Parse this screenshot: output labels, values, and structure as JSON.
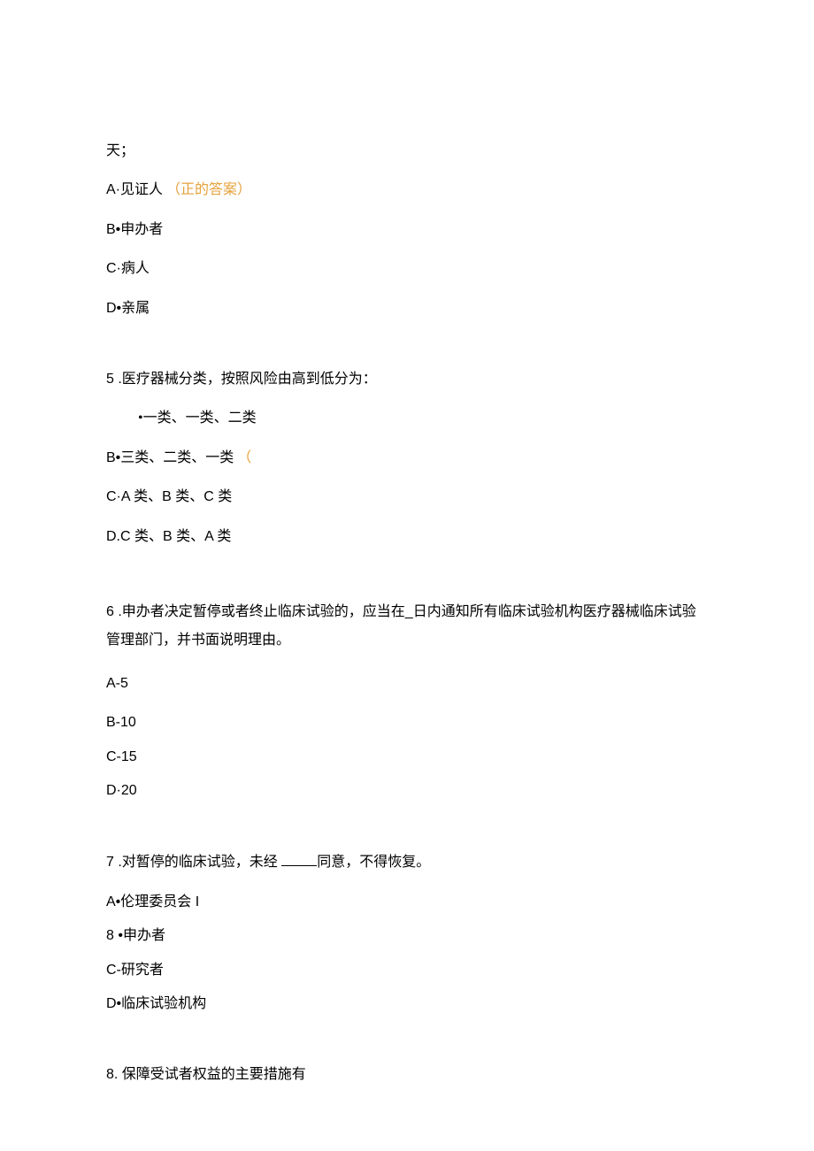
{
  "q4": {
    "tail": "天；",
    "opts": {
      "A": "A·见证人",
      "A_hint": "（正的答案）",
      "B": "B•申办者",
      "C": "C·病人",
      "D": "D•亲属"
    }
  },
  "q5": {
    "stem": "5  .医疗器械分类，按照风险由高到低分为：",
    "opts": {
      "A": "•一类、一类、二类",
      "B": "B•三类、二类、一类",
      "B_hint": "（",
      "C": "C·A 类、B 类、C 类",
      "D": "D.C 类、B 类、A 类"
    }
  },
  "q6": {
    "stem": "6  .申办者决定暂停或者终止临床试验的，应当在_日内通知所有临床试验机构医疗器械临床试验管理部门，并书面说明理由。",
    "opts": {
      "A": "A-5",
      "B": "B-10",
      "C": "C-15",
      "D": "D·20"
    }
  },
  "q7": {
    "stem_pre": "7  .对暂停的临床试验，未经 ",
    "stem_post": "同意，不得恢复。",
    "opts": {
      "A": "A•伦理委员会 I",
      "B": "8   •申办者",
      "C": "C-研究者",
      "D": "D•临床试验机构"
    }
  },
  "q8": {
    "stem": "8. 保障受试者权益的主要措施有"
  }
}
